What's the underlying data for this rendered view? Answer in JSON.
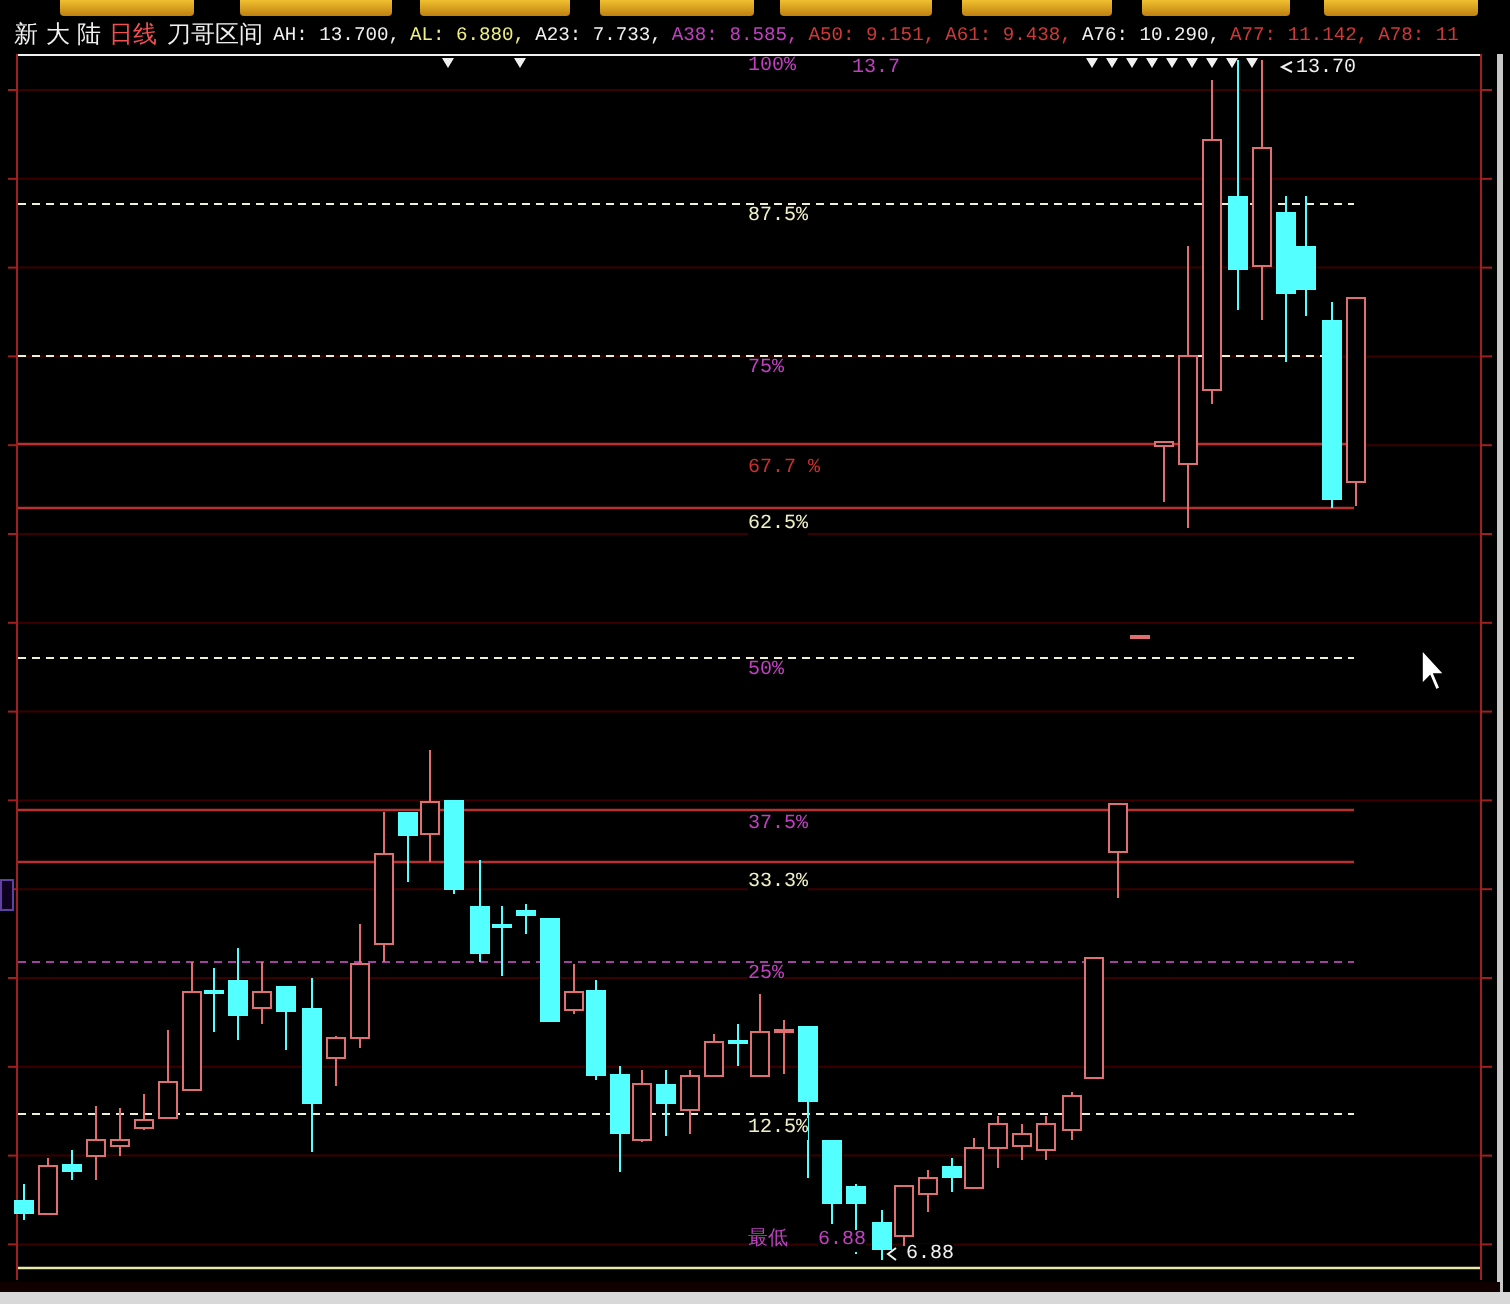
{
  "info_line": {
    "stock": "新 大 陆",
    "period": "日线",
    "indicator": "刀哥区间",
    "values": [
      {
        "text": "AH: 13.700,",
        "color": "#f0f0f0"
      },
      {
        "text": "AL: 6.880,",
        "color": "#f0f080"
      },
      {
        "text": "A23: 7.733,",
        "color": "#f0f0f0"
      },
      {
        "text": "A38: 8.585,",
        "color": "#c040c0"
      },
      {
        "text": "A50: 9.151,",
        "color": "#d03838"
      },
      {
        "text": "A61: 9.438,",
        "color": "#d03838"
      },
      {
        "text": "A76: 10.290,",
        "color": "#f0f0f0"
      },
      {
        "text": "A77: 11.142,",
        "color": "#d03838"
      },
      {
        "text": "A78: 11",
        "color": "#d03838"
      }
    ]
  },
  "levels": [
    {
      "label": "100%",
      "value": "13.7",
      "color": "#c040c0",
      "kind": "none"
    },
    {
      "label": "87.5%",
      "color": "#f0f0c8",
      "kind": "dashed"
    },
    {
      "label": "75%",
      "color": "#c040c0",
      "kind": "dashed"
    },
    {
      "label": "67.7 %",
      "color": "#c83030",
      "kind": "solid"
    },
    {
      "label": "62.5%",
      "color": "#f0f0c8",
      "kind": "solid"
    },
    {
      "label": "50%",
      "color": "#c040c0",
      "kind": "dashed"
    },
    {
      "label": "37.5%",
      "color": "#c040c0",
      "kind": "solid"
    },
    {
      "label": "33.3%",
      "color": "#f0f0c8",
      "kind": "solid"
    },
    {
      "label": "25%",
      "color": "#c040c0",
      "kind": "faint"
    },
    {
      "label": "12.5%",
      "color": "#f0f0c8",
      "kind": "dashed"
    },
    {
      "label": "最低",
      "value": "6.88",
      "color": "#c040c0",
      "kind": "base"
    }
  ],
  "high_marker": "13.70",
  "low_marker": "6.88"
}
